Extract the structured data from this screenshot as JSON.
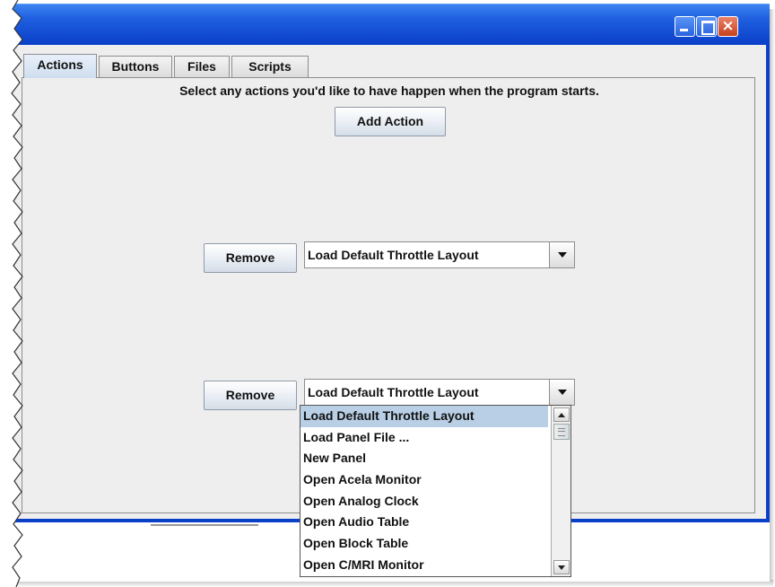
{
  "window": {
    "title": "",
    "controls": {
      "minimize": "minimize",
      "maximize": "maximize",
      "close": "×"
    }
  },
  "tabs": [
    {
      "label": "Actions",
      "active": true
    },
    {
      "label": "Buttons",
      "active": false
    },
    {
      "label": "Files",
      "active": false
    },
    {
      "label": "Scripts",
      "active": false
    }
  ],
  "actions_panel": {
    "intro": "Select any actions you'd like to have happen when the program starts.",
    "add_action_label": "Add Action",
    "rows": [
      {
        "remove_label": "Remove",
        "selected_action": "Load Default Throttle Layout"
      },
      {
        "remove_label": "Remove",
        "selected_action": "Load Default Throttle Layout"
      }
    ]
  },
  "dropdown": {
    "open": true,
    "selected_index": 0,
    "options": [
      "Load Default Throttle Layout",
      "Load Panel File ...",
      "New Panel",
      "Open Acela Monitor",
      "Open Analog Clock",
      "Open Audio Table",
      "Open Block Table",
      "Open C/MRI Monitor"
    ]
  },
  "colors": {
    "titlebar": "#1f5fe0",
    "window_border": "#0a3fc8",
    "panel_bg": "#eeeeee",
    "selection": "#b8cfe5",
    "close_button": "#c8401c"
  },
  "icons": {
    "minimize": "minimize-icon",
    "maximize": "maximize-icon",
    "close": "close-icon",
    "dropdown_arrow": "chevron-down-icon"
  }
}
